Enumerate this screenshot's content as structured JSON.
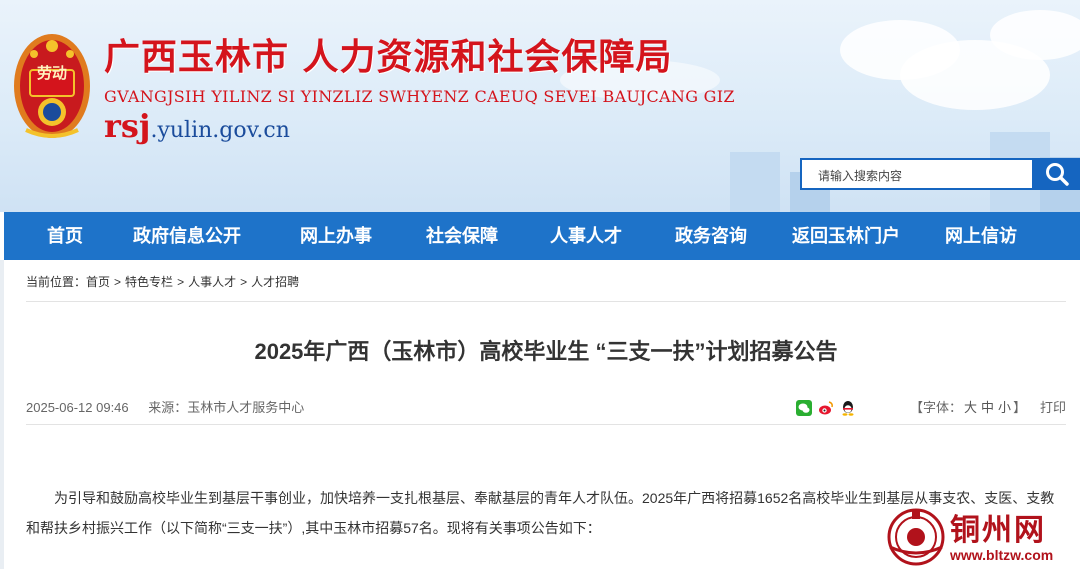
{
  "header": {
    "title": "广西玉林市 人力资源和社会保障局",
    "pinyin": "GVANGJSIH YILINZ SI YINZLIZ SWHYENZ CAEUQ SEVEI BAUJCANG GIZ",
    "domain_prefix": "rsj",
    "domain_suffix": ".yulin.gov.cn",
    "emblem_text": "劳动"
  },
  "search": {
    "placeholder": "请输入搜索内容",
    "icon": "search-icon"
  },
  "nav": {
    "items": [
      {
        "label": "首页"
      },
      {
        "label": "政府信息公开"
      },
      {
        "label": "网上办事"
      },
      {
        "label": "社会保障"
      },
      {
        "label": "人事人才"
      },
      {
        "label": "政务咨询"
      },
      {
        "label": "返回玉林门户"
      },
      {
        "label": "网上信访"
      }
    ]
  },
  "breadcrumb": {
    "label": "当前位置：",
    "items": [
      "首页",
      "特色专栏",
      "人事人才",
      "人才招聘"
    ],
    "separator": ">"
  },
  "article": {
    "title": "2025年广西（玉林市）高校毕业生 “三支一扶”计划招募公告",
    "date": "2025-06-12 09:46",
    "source_label": "来源：",
    "source": "玉林市人才服务中心",
    "share_icons": [
      "wechat-icon",
      "weibo-icon",
      "qq-icon"
    ],
    "font_size_label_open": "【字体：",
    "font_sizes": [
      "大",
      "中",
      "小"
    ],
    "font_size_label_close": "】",
    "print_label": "打印",
    "body": "为引导和鼓励高校毕业生到基层干事创业，加快培养一支扎根基层、奉献基层的青年人才队伍。2025年广西将招募1652名高校毕业生到基层从事支农、支医、支教和帮扶乡村振兴工作（以下简称“三支一扶”）,其中玉林市招募57名。现将有关事项公告如下："
  },
  "watermark": {
    "name": "铜州网",
    "url": "www.bltzw.com"
  },
  "colors": {
    "brand_red": "#d4141c",
    "nav_blue": "#1e73c9",
    "search_blue": "#1565c0"
  }
}
